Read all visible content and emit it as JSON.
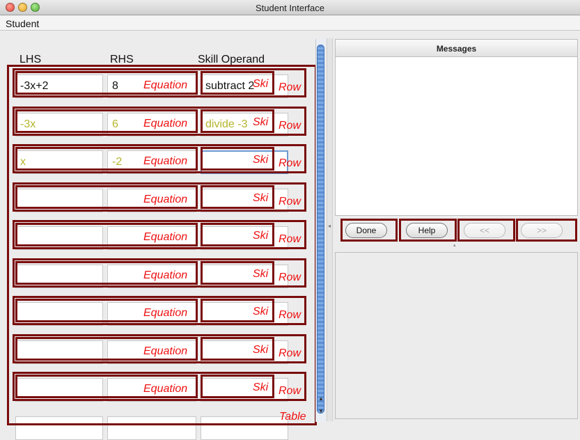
{
  "window": {
    "title": "Student Interface"
  },
  "menu": {
    "student": "Student"
  },
  "table": {
    "headers": {
      "lhs": "LHS",
      "rhs": "RHS",
      "skill_operand": "Skill Operand"
    },
    "rows": [
      {
        "lhs": "-3x+2",
        "rhs": "8",
        "skill": "subtract 2"
      },
      {
        "lhs": "-3x",
        "rhs": "6",
        "skill": "divide -3"
      },
      {
        "lhs": "x",
        "rhs": "-2",
        "skill": ""
      },
      {
        "lhs": "",
        "rhs": "",
        "skill": ""
      },
      {
        "lhs": "",
        "rhs": "",
        "skill": ""
      },
      {
        "lhs": "",
        "rhs": "",
        "skill": ""
      },
      {
        "lhs": "",
        "rhs": "",
        "skill": ""
      },
      {
        "lhs": "",
        "rhs": "",
        "skill": ""
      },
      {
        "lhs": "",
        "rhs": "",
        "skill": ""
      },
      {
        "lhs": "",
        "rhs": "",
        "skill": ""
      }
    ]
  },
  "annotations": {
    "equation": "Equation",
    "skill": "Ski",
    "row": "Row",
    "table": "Table",
    "color": "#ee1111",
    "box_color": "#7a0c0c"
  },
  "messages": {
    "header": "Messages"
  },
  "buttons": {
    "done": "Done",
    "help": "Help",
    "prev": "<<",
    "next": ">>"
  },
  "colors": {
    "entered_text": "#111111",
    "auto_text": "#b5b52c",
    "focus": "#6e9ad3"
  },
  "scroll": {
    "up_arrow": "▲",
    "down_arrow": "▼",
    "pane_left_arrow": "◂",
    "pane_up_arrow": "▴"
  }
}
